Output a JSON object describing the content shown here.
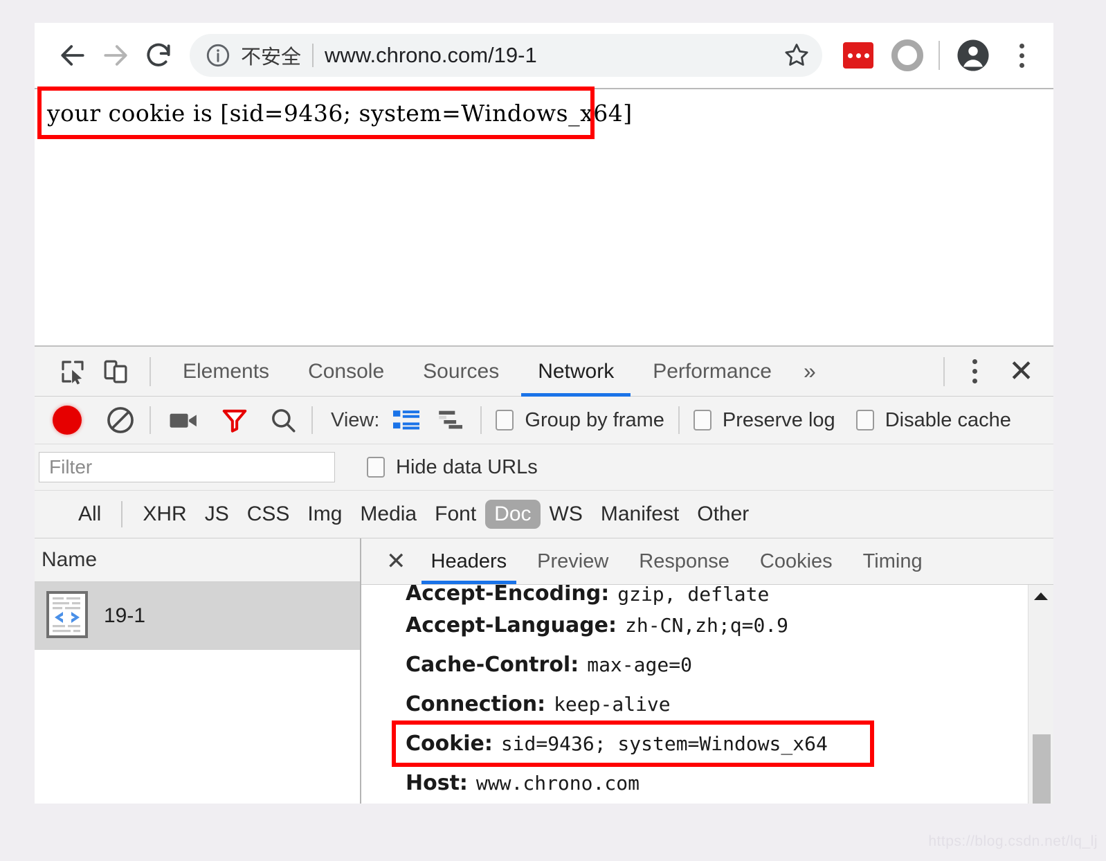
{
  "browser": {
    "toolbar": {
      "back_icon": "back-arrow-icon",
      "forward_icon": "forward-arrow-icon",
      "reload_icon": "reload-icon",
      "security_icon": "info-circle-icon",
      "security_label": "不安全",
      "url": "www.chrono.com/19-1",
      "bookmark_icon": "star-icon",
      "extension_icon": "extension-icon",
      "ring_icon": "circle-ring-icon",
      "profile_icon": "profile-avatar-icon",
      "menu_icon": "three-dot-menu-icon"
    }
  },
  "page": {
    "body_text": "your cookie is [sid=9436; system=Windows_x64]"
  },
  "devtools": {
    "inspect_icon": "inspect-element-icon",
    "device_icon": "device-toolbar-icon",
    "tabs": [
      {
        "label": "Elements",
        "active": false
      },
      {
        "label": "Console",
        "active": false
      },
      {
        "label": "Sources",
        "active": false
      },
      {
        "label": "Network",
        "active": true
      },
      {
        "label": "Performance",
        "active": false
      }
    ],
    "more_tabs_icon": "chevron-double-right-icon",
    "more_tabs_label": "»",
    "kebab_icon": "three-dot-menu-icon",
    "close_label": "✕",
    "network_toolbar": {
      "record_icon": "record-button-icon",
      "clear_icon": "clear-icon",
      "camera_icon": "screenshot-camera-icon",
      "filter_icon": "filter-funnel-icon",
      "search_icon": "search-icon",
      "view_label": "View:",
      "list_view_icon": "list-view-icon",
      "waterfall_view_icon": "waterfall-view-icon",
      "checkboxes": [
        {
          "label": "Group by frame",
          "checked": false
        },
        {
          "label": "Preserve log",
          "checked": false
        },
        {
          "label": "Disable cache",
          "checked": false
        }
      ]
    },
    "filter_row": {
      "filter_placeholder": "Filter",
      "filter_value": "",
      "hide_data_urls_label": "Hide data URLs",
      "hide_data_urls_checked": false
    },
    "type_filters": {
      "all": "All",
      "items": [
        "XHR",
        "JS",
        "CSS",
        "Img",
        "Media",
        "Font",
        "Doc",
        "WS",
        "Manifest",
        "Other"
      ],
      "selected": "Doc"
    },
    "request_list": {
      "column_header": "Name",
      "rows": [
        {
          "name": "19-1",
          "icon": "document-code-icon",
          "selected": true
        }
      ]
    },
    "detail": {
      "close_label": "✕",
      "tabs": [
        {
          "label": "Headers",
          "active": true
        },
        {
          "label": "Preview",
          "active": false
        },
        {
          "label": "Response",
          "active": false
        },
        {
          "label": "Cookies",
          "active": false
        },
        {
          "label": "Timing",
          "active": false
        }
      ],
      "headers": [
        {
          "key": "Accept-Encoding:",
          "value": "gzip, deflate",
          "clipped": true,
          "highlighted": false
        },
        {
          "key": "Accept-Language:",
          "value": "zh-CN,zh;q=0.9",
          "clipped": false,
          "highlighted": false
        },
        {
          "key": "Cache-Control:",
          "value": "max-age=0",
          "clipped": false,
          "highlighted": false
        },
        {
          "key": "Connection:",
          "value": "keep-alive",
          "clipped": false,
          "highlighted": false
        },
        {
          "key": "Cookie:",
          "value": "sid=9436; system=Windows_x64",
          "clipped": false,
          "highlighted": true
        },
        {
          "key": "Host:",
          "value": "www.chrono.com",
          "clipped": false,
          "highlighted": false
        }
      ],
      "scrollbar_up_icon": "scroll-up-arrow-icon"
    }
  },
  "annotations": {
    "highlight_color": "#ff0000",
    "page_box_target": "your cookie is [sid=9436; system=Windows_x64]",
    "header_box_target": "Cookie: sid=9436; system=Windows_x64"
  },
  "watermark": "https://blog.csdn.net/lq_lj"
}
